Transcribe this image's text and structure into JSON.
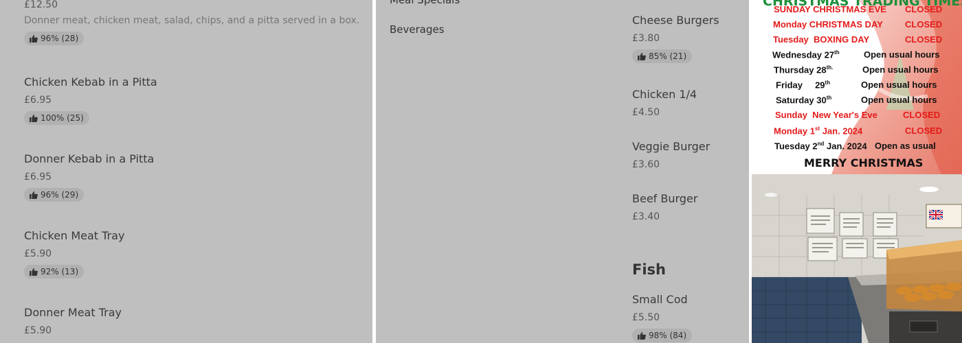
{
  "left_items": [
    {
      "name": "",
      "price": "£12.50",
      "description": "Donner meat, chicken meat, salad, chips, and a pitta served in a box.",
      "rating": "96% (28)"
    },
    {
      "name": "Chicken Kebab in a Pitta",
      "price": "£6.95",
      "rating": "100% (25)"
    },
    {
      "name": "Donner Kebab in a Pitta",
      "price": "£6.95",
      "rating": "96% (29)"
    },
    {
      "name": "Chicken Meat Tray",
      "price": "£5.90",
      "rating": "92% (13)"
    },
    {
      "name": "Donner Meat Tray",
      "price": "£5.90",
      "rating": ""
    }
  ],
  "categories": [
    "Meal Specials",
    "Beverages"
  ],
  "mid_items": [
    {
      "name": "Cheese Burgers",
      "price": "£3.80",
      "rating": "85% (21)"
    },
    {
      "name": "Chicken 1/4",
      "price": "£4.50"
    },
    {
      "name": "Veggie Burger",
      "price": "£3.60"
    },
    {
      "name": "Beef Burger",
      "price": "£3.40"
    }
  ],
  "fish_section": {
    "title": "Fish",
    "items": [
      {
        "name": "Small Cod",
        "price": "£5.50",
        "rating": "98% (84)"
      }
    ]
  },
  "xmas_notice": {
    "title": "CHRISTMAS TRADING TIMES",
    "rows": [
      {
        "day": "SUNDAY CHRISTMAS EVE",
        "status": "CLOSED",
        "color": "#e31b1b"
      },
      {
        "day": "Monday CHRISTMAS DAY",
        "status": "CLOSED",
        "color": "#e31b1b"
      },
      {
        "day": "Tuesday  BOXING DAY",
        "status": "CLOSED",
        "color": "#e31b1b"
      },
      {
        "day": "Wednesday 27",
        "sup": "th",
        "status": "Open usual hours",
        "color": "#111111"
      },
      {
        "day": "Thursday 28",
        "sup": "th.",
        "status": "Open usual hours",
        "color": "#111111"
      },
      {
        "day": "Friday     29",
        "sup": "th",
        "status": "Open usual hours",
        "color": "#111111"
      },
      {
        "day": "Saturday 30",
        "sup": "th",
        "status": "Open usual hours",
        "color": "#111111"
      },
      {
        "day": "Sunday  New Year's Eve",
        "status": "CLOSED",
        "color": "#e31b1b"
      },
      {
        "day": "Monday 1",
        "sup": "st",
        "day_suffix": " Jan. 2024",
        "status": "CLOSED",
        "color": "#e31b1b"
      },
      {
        "day": "Tuesday 2",
        "sup": "nd",
        "day_suffix": " Jan. 2024",
        "status": "Open as usual",
        "color": "#111111"
      }
    ],
    "footer": "MERRY CHRISTMAS"
  },
  "shop_photo": {
    "sign_flag": "union-jack"
  }
}
